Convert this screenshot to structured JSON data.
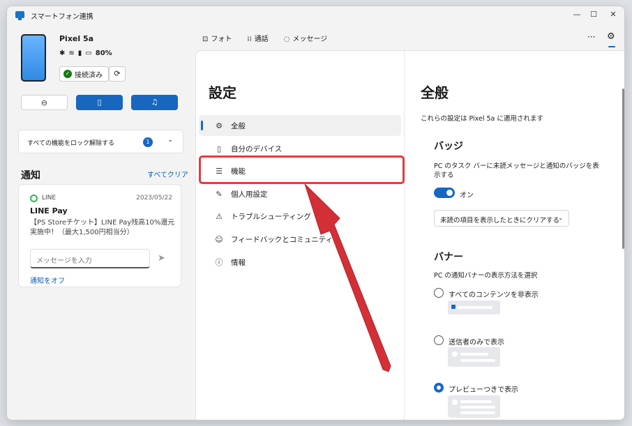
{
  "window": {
    "title": "スマートフォン連携",
    "controls": [
      "—",
      "☐",
      "✕"
    ]
  },
  "device": {
    "name": "Pixel 5a",
    "battery": "80%",
    "status_icons": [
      "✱",
      "≋",
      "▮",
      "▭"
    ],
    "connected_label": "接続済み",
    "sync_icon": "⟳"
  },
  "quick_actions": [
    {
      "icon": "⊖",
      "style": "light",
      "name": "do-not-disturb-button"
    },
    {
      "icon": "▯",
      "style": "blue",
      "name": "vibrate-button"
    },
    {
      "icon": "♫",
      "style": "blue",
      "name": "music-button"
    }
  ],
  "unlock": {
    "label": "すべての機能をロック解除する",
    "count": "1",
    "chevron": "⌄"
  },
  "notifications": {
    "title": "通知",
    "clear_all": "すべてクリア",
    "card": {
      "app": "LINE",
      "date": "2023/05/22",
      "title": "LINE Pay",
      "body": "【PS Storeチケット】LINE Pay残高10%還元実施中！（最大1,500円相当分）",
      "input_placeholder": "メッセージを入力",
      "send_icon": "➤",
      "turn_off": "通知をオフ"
    }
  },
  "nav": {
    "photos": "フォト",
    "calls": "通話",
    "messages": "メッセージ",
    "more": "···",
    "settings_icon": "⚙"
  },
  "settings": {
    "title": "設定",
    "menu": [
      {
        "label": "全般",
        "icon": "⚙"
      },
      {
        "label": "自分のデバイス",
        "icon": "▯"
      },
      {
        "label": "機能",
        "icon": "☰"
      },
      {
        "label": "個人用設定",
        "icon": "✎"
      },
      {
        "label": "トラブルシューティング",
        "icon": "⚠"
      },
      {
        "label": "フィードバックとコミュニティ",
        "icon": "☺"
      },
      {
        "label": "情報",
        "icon": "ⓘ"
      }
    ]
  },
  "general": {
    "title": "全般",
    "applied_to": "これらの設定は Pixel 5a に適用されます",
    "badge": {
      "title": "バッジ",
      "description": "PC のタスク バーに未読メッセージと通知のバッジを表示する",
      "toggle_on": true,
      "toggle_label": "オン",
      "dropdown_value": "未読の項目を表示したときにクリアする"
    },
    "banner": {
      "title": "バナー",
      "description": "PC の通知バナーの表示方法を選択",
      "options": [
        {
          "label": "すべてのコンテンツを非表示",
          "selected": false
        },
        {
          "label": "送信者のみで表示",
          "selected": false
        },
        {
          "label": "プレビューつきで表示",
          "selected": true
        }
      ]
    }
  },
  "colors": {
    "accent": "#1767c0",
    "highlight": "#e8393f",
    "arrow": "#d32f36"
  }
}
